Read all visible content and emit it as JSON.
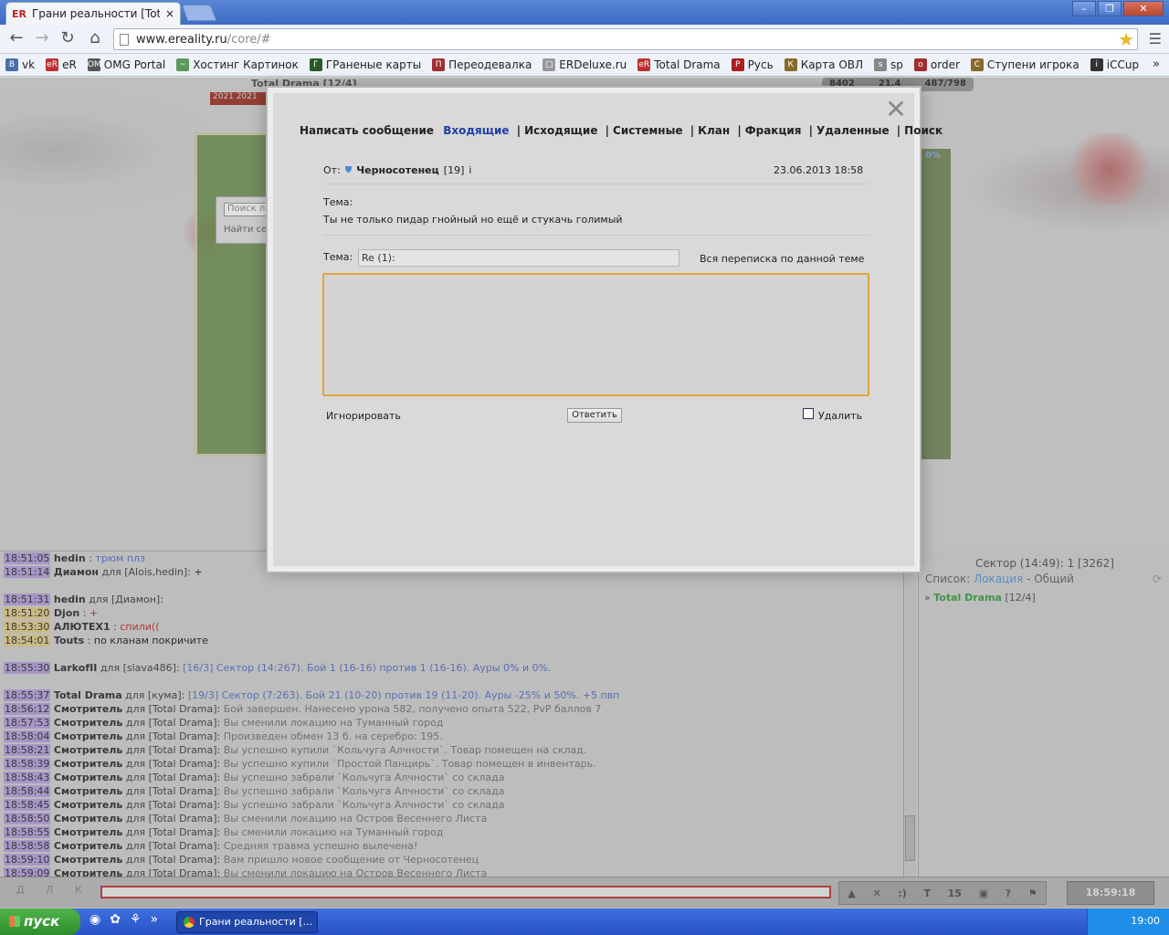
{
  "browser": {
    "tab_title": "Грани реальности [Total Dra",
    "tab_favicon": "ER",
    "url_host": "www.ereality.ru",
    "url_path": "/core/#"
  },
  "bookmarks": [
    {
      "icon": "B",
      "label": "vk",
      "color": "#4a6ea8"
    },
    {
      "icon": "eR",
      "label": "eR",
      "color": "#c03030"
    },
    {
      "icon": "OMG",
      "label": "OMG Portal",
      "color": "#555"
    },
    {
      "icon": "~",
      "label": "Хостинг Картинок",
      "color": "#5a9a5a"
    },
    {
      "icon": "Г",
      "label": "ГРаненые карты",
      "color": "#2a5a2a"
    },
    {
      "icon": "П",
      "label": "Переодевалка",
      "color": "#a03030"
    },
    {
      "icon": "□",
      "label": "ERDeluxe.ru",
      "color": "#999"
    },
    {
      "icon": "eR",
      "label": "Total Drama",
      "color": "#c03030"
    },
    {
      "icon": "Р",
      "label": "Русь",
      "color": "#a82020"
    },
    {
      "icon": "К",
      "label": "Карта ОВЛ",
      "color": "#8a6a2a"
    },
    {
      "icon": "s",
      "label": "sp",
      "color": "#888"
    },
    {
      "icon": "o",
      "label": "order",
      "color": "#a03030"
    },
    {
      "icon": "С",
      "label": "Ступени игрока",
      "color": "#8a6a2a"
    },
    {
      "icon": "i",
      "label": "iCCup",
      "color": "#333"
    }
  ],
  "game": {
    "top_title": "Total Drama [12/4]",
    "top_tag": "2021 2021",
    "stats": [
      "8402",
      "21.4",
      "487/798"
    ],
    "search_placeholder": "Поиск ло",
    "search_label": "Найти сек",
    "right_pct": "0%"
  },
  "modal": {
    "nav": [
      "Написать сообщение",
      "Входящие",
      "Исходящие",
      "Системные",
      "Клан",
      "Фракция",
      "Удаленные",
      "Поиск"
    ],
    "from_label": "От:",
    "from_name": "Черносотенец",
    "from_level": "[19]",
    "date": "23.06.2013 18:58",
    "subject_label": "Тема:",
    "body": "Ты не только пидар гнойный но ещё и стукачь голимый",
    "reply_subject_label": "Тема:",
    "reply_subject_value": "Re (1):",
    "thread_link": "Вся переписка по данной теме",
    "ignore": "Игнорировать",
    "reply_button": "Ответить",
    "delete_label": "Удалить"
  },
  "chat": [
    {
      "t": "18:51:05",
      "y": false,
      "nick": "hedin",
      "to": ":",
      "msg": "трюм плз",
      "cls": "blue"
    },
    {
      "t": "18:51:14",
      "y": false,
      "nick": "Диамон",
      "to": "для [Alois,hedin]:",
      "msg": "+",
      "cls": ""
    },
    {
      "t": "",
      "y": false,
      "nick": "",
      "to": "",
      "msg": "",
      "cls": ""
    },
    {
      "t": "18:51:31",
      "y": false,
      "nick": "hedin",
      "to": "для [Диамон]:",
      "msg": "",
      "cls": ""
    },
    {
      "t": "18:51:20",
      "y": true,
      "nick": "Djon",
      "to": ":",
      "msg": "+",
      "cls": "red"
    },
    {
      "t": "18:53:30",
      "y": true,
      "nick": "АЛЮТЕХ1",
      "to": ":",
      "msg": "спили((",
      "cls": "red"
    },
    {
      "t": "18:54:01",
      "y": true,
      "nick": "Touts",
      "to": ":",
      "msg": "по кланам покричите",
      "cls": ""
    },
    {
      "t": "",
      "y": false,
      "nick": "",
      "to": "",
      "msg": "",
      "cls": ""
    },
    {
      "t": "18:55:30",
      "y": false,
      "nick": "LarkofII",
      "to": "для [slava486]:",
      "msg": "[16/3]  Сектор (14:267). Бой 1 (16-16) против 1 (16-16). Ауры 0% и 0%.",
      "cls": "blue"
    },
    {
      "t": "",
      "y": false,
      "nick": "",
      "to": "",
      "msg": "",
      "cls": ""
    },
    {
      "t": "18:55:37",
      "y": false,
      "nick": "Total Drama",
      "to": "для [кума]:",
      "msg": "[19/3]  Сектор (7:263). Бой 21 (10-20) против 19 (11-20). Ауры -25% и 50%. +5 пвп",
      "cls": "blue"
    },
    {
      "t": "18:56:12",
      "y": false,
      "nick": "Смотритель",
      "to": "для [Total Drama]:",
      "msg": "Бой завершен. Нанесено урона 582, получено опыта 522, PvP баллов 7",
      "cls": "sys"
    },
    {
      "t": "18:57:53",
      "y": false,
      "nick": "Смотритель",
      "to": "для [Total Drama]:",
      "msg": "Вы сменили локацию на Туманный город",
      "cls": "sys"
    },
    {
      "t": "18:58:04",
      "y": false,
      "nick": "Смотритель",
      "to": "для [Total Drama]:",
      "msg": "Произведен обмен 13 б. на серебро: 195.",
      "cls": "sys"
    },
    {
      "t": "18:58:21",
      "y": false,
      "nick": "Смотритель",
      "to": "для [Total Drama]:",
      "msg": "Вы успешно купили `Кольчуга Алчности`. Товар помещен на склад.",
      "cls": "sys"
    },
    {
      "t": "18:58:39",
      "y": false,
      "nick": "Смотритель",
      "to": "для [Total Drama]:",
      "msg": "Вы успешно купили `Простой Панцирь`. Товар помещен в инвентарь.",
      "cls": "sys"
    },
    {
      "t": "18:58:43",
      "y": false,
      "nick": "Смотритель",
      "to": "для [Total Drama]:",
      "msg": "Вы успешно забрали `Кольчуга Алчности` со склада",
      "cls": "sys"
    },
    {
      "t": "18:58:44",
      "y": false,
      "nick": "Смотритель",
      "to": "для [Total Drama]:",
      "msg": "Вы успешно забрали `Кольчуга Алчности` со склада",
      "cls": "sys"
    },
    {
      "t": "18:58:45",
      "y": false,
      "nick": "Смотритель",
      "to": "для [Total Drama]:",
      "msg": "Вы успешно забрали `Кольчуга Алчности` со склада",
      "cls": "sys"
    },
    {
      "t": "18:58:50",
      "y": false,
      "nick": "Смотритель",
      "to": "для [Total Drama]:",
      "msg": "Вы сменили локацию на Остров Весеннего Листа",
      "cls": "sys"
    },
    {
      "t": "18:58:55",
      "y": false,
      "nick": "Смотритель",
      "to": "для [Total Drama]:",
      "msg": "Вы сменили локацию на Туманный город",
      "cls": "sys"
    },
    {
      "t": "18:58:58",
      "y": false,
      "nick": "Смотритель",
      "to": "для [Total Drama]:",
      "msg": "Средняя травма успешно вылечена!",
      "cls": "sys"
    },
    {
      "t": "18:59:10",
      "y": false,
      "nick": "Смотритель",
      "to": "для [Total Drama]:",
      "msg": "Вам пришло новое сообщение от Черносотенец",
      "cls": "sys"
    },
    {
      "t": "18:59:09",
      "y": false,
      "nick": "Смотритель",
      "to": "для [Total Drama]:",
      "msg": "Вы сменили локацию на Остров Весеннего Листа",
      "cls": "sys"
    }
  ],
  "sidebar": {
    "sector": "Сектор (14:49): 1 [3262]",
    "list_label": "Список:",
    "list_loc": "Локация",
    "list_rest": "- Общий",
    "player": "Total Drama",
    "player_lvl": "[12/4]"
  },
  "bottom": {
    "left_letters": "Д Л К Б",
    "toolbar": [
      "▲",
      "✕",
      ":)",
      "T",
      "15",
      "▣",
      "?",
      "⚑"
    ],
    "clock": "18:59:18"
  },
  "taskbar": {
    "start": "пуск",
    "task": "Грани реальности [...",
    "time": "19:00"
  }
}
